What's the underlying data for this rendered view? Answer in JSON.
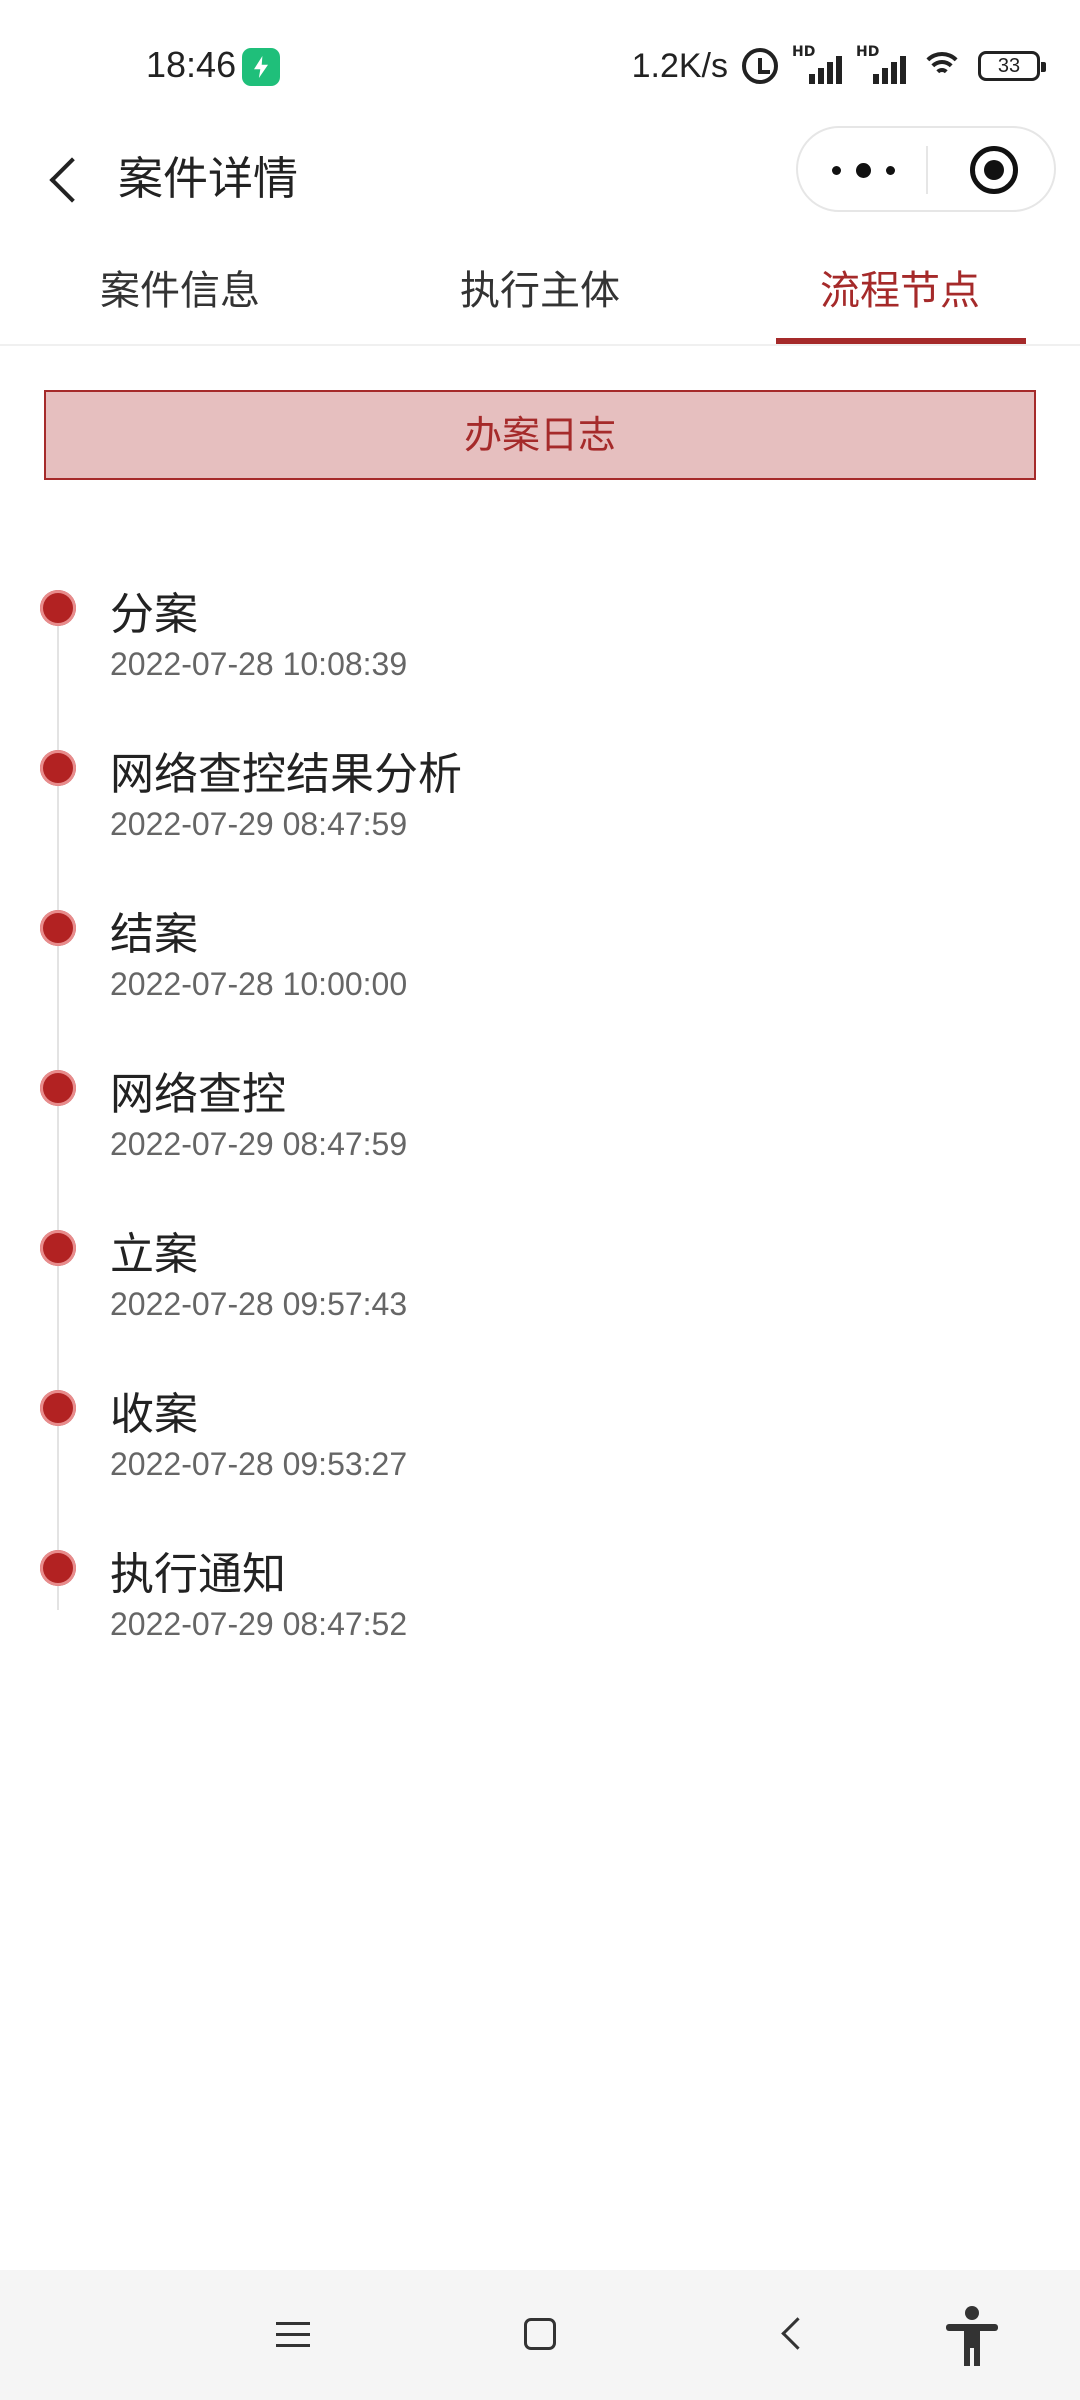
{
  "status_bar": {
    "time": "18:46",
    "net_speed": "1.2K/s",
    "signal_label_1": "HD",
    "signal_label_2": "HD",
    "battery": "33",
    "icons": [
      "app-charge-icon",
      "alarm-icon",
      "signal-icon",
      "signal-icon",
      "wifi-icon",
      "battery-icon"
    ]
  },
  "nav": {
    "title": "案件详情",
    "back_icon": "chevron-left-icon",
    "more_icon": "more-dots-icon",
    "close_icon": "target-circle-icon"
  },
  "tabs": [
    {
      "label": "案件信息",
      "active": false
    },
    {
      "label": "执行主体",
      "active": false
    },
    {
      "label": "流程节点",
      "active": true
    }
  ],
  "log_button": {
    "label": "办案日志"
  },
  "timeline": [
    {
      "title": "分案",
      "time": "2022-07-28 10:08:39"
    },
    {
      "title": "网络查控结果分析",
      "time": "2022-07-29 08:47:59"
    },
    {
      "title": "结案",
      "time": "2022-07-28 10:00:00"
    },
    {
      "title": "网络查控",
      "time": "2022-07-29 08:47:59"
    },
    {
      "title": "立案",
      "time": "2022-07-28 09:57:43"
    },
    {
      "title": "收案",
      "time": "2022-07-28 09:53:27"
    },
    {
      "title": "执行通知",
      "time": "2022-07-29 08:47:52"
    }
  ],
  "colors": {
    "accent": "#a52a2a",
    "button_bg": "#e6bfbf",
    "dot": "#b22222"
  },
  "system_nav": {
    "icons": [
      "menu-icon",
      "home-icon",
      "back-icon",
      "accessibility-icon"
    ]
  }
}
